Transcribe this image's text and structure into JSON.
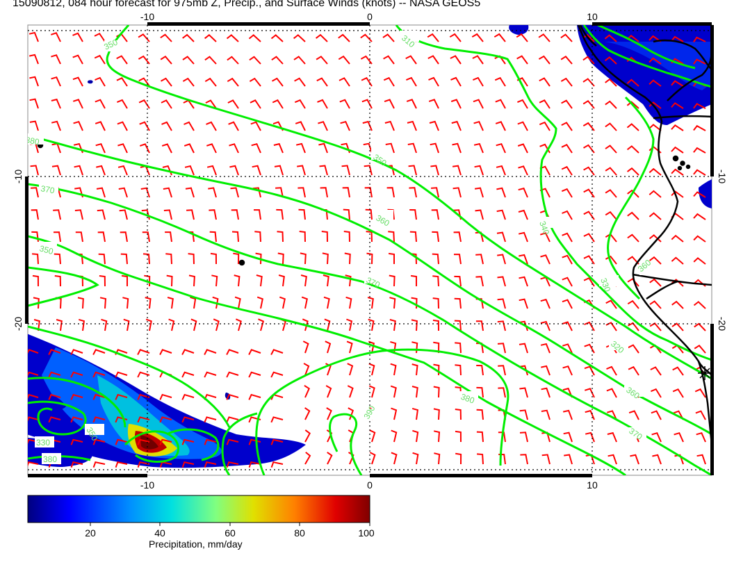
{
  "title": "15090812, 084 hour forecast for 975mb Z, Precip., and Surface Winds (knots) -- NASA GEOS5",
  "axes": {
    "top_ticks": [
      "-10",
      "0",
      "10"
    ],
    "bottom_ticks": [
      "-10",
      "0",
      "10"
    ],
    "left_ticks": [
      "-10",
      "-20"
    ],
    "right_ticks": [
      "-10",
      "-20"
    ]
  },
  "contour_labels": [
    {
      "text": "350"
    },
    {
      "text": "310"
    },
    {
      "text": "380"
    },
    {
      "text": "350"
    },
    {
      "text": "370"
    },
    {
      "text": "360"
    },
    {
      "text": "350"
    },
    {
      "text": "370"
    },
    {
      "text": "340"
    },
    {
      "text": "330"
    },
    {
      "text": "320"
    },
    {
      "text": "360"
    },
    {
      "text": "380"
    },
    {
      "text": "390"
    },
    {
      "text": "370"
    },
    {
      "text": "350"
    },
    {
      "text": "330"
    },
    {
      "text": "380"
    },
    {
      "text": "360"
    }
  ],
  "colorbar": {
    "ticks": [
      "20",
      "40",
      "60",
      "80",
      "100"
    ],
    "label": "Precipitation, mm/day",
    "colors": [
      "#00007f",
      "#0000ff",
      "#0080ff",
      "#00e0ff",
      "#80ff80",
      "#e0e000",
      "#ff8000",
      "#e00000",
      "#800000"
    ]
  },
  "colors": {
    "contour": "#00ee00",
    "barb": "#ff0000",
    "coast": "#000000"
  }
}
